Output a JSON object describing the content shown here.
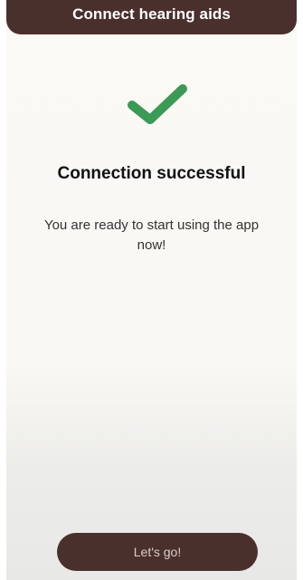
{
  "header": {
    "title": "Connect hearing aids"
  },
  "status": {
    "icon": "checkmark-icon",
    "heading": "Connection successful",
    "message": "You are ready to start using the app now!"
  },
  "actions": {
    "primary_label": "Let's go!"
  },
  "colors": {
    "brand": "#4a302d",
    "success": "#3a9a56",
    "background": "#fbf9f4"
  }
}
